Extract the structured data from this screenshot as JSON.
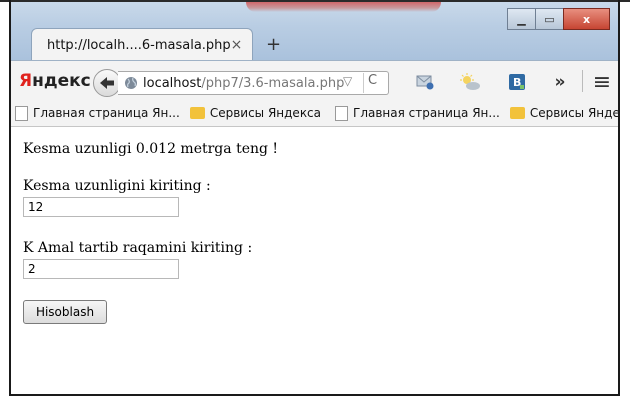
{
  "tab": {
    "title": "http://localh....6-masala.php",
    "close": "×",
    "new_tab": "+"
  },
  "window_controls": {
    "minimize": "▁",
    "maximize": "▭",
    "close": "x"
  },
  "nav": {
    "brand": "Яндекс",
    "brand_first": "Я",
    "brand_rest": "ндекс",
    "back": "🡨",
    "url_host": "localhost",
    "url_path": "/php7/3.6-masala.php",
    "url_dropdown": "▽",
    "url_reload": "C",
    "overflow": "»",
    "menu": "≡"
  },
  "bookmarks": [
    {
      "label": "Главная страница Ян...",
      "icon": "page-icon"
    },
    {
      "label": "Сервисы Яндекса",
      "icon": "folder-icon"
    },
    {
      "label": "Главная страница Ян...",
      "icon": "page-icon"
    },
    {
      "label": "Сервисы Яндекса",
      "icon": "folder-icon"
    }
  ],
  "bookmarks_more": "»",
  "page": {
    "result": "Kesma uzunligi 0.012 metrga teng !",
    "length_label": "Kesma uzunligini kiriting :",
    "length_value": "12",
    "k_label": "K Amal tartib raqamini kiriting :",
    "k_value": "2",
    "submit": "Hisoblash"
  },
  "colors": {
    "titlebar": "#b9cde3",
    "close_button": "#c64533",
    "yandex_red": "#e0221d",
    "folder": "#f2c23b"
  }
}
